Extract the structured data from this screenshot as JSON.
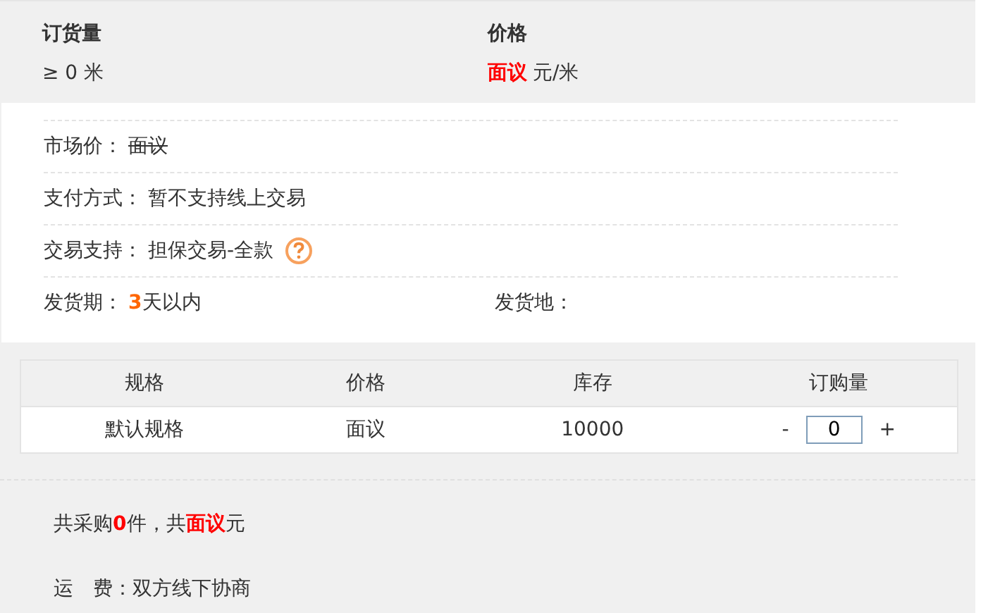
{
  "header": {
    "quantity_label": "订货量",
    "quantity_value": "≥ 0  米",
    "price_label": "价格",
    "price_value": "面议",
    "price_unit": "元/米"
  },
  "details": [
    {
      "label": "市场价：",
      "value": "面议",
      "strikethrough": true,
      "kind": "plain"
    },
    {
      "label": "支付方式：",
      "value": "暂不支持线上交易",
      "strikethrough": false,
      "kind": "plain"
    },
    {
      "label": "交易支持：",
      "value": "担保交易-全款",
      "strikethrough": false,
      "kind": "help"
    }
  ],
  "delivery": {
    "period_label": "发货期：",
    "period_number": "3",
    "period_text": "天以内",
    "place_label": "发货地："
  },
  "table": {
    "columns": [
      "规格",
      "价格",
      "库存",
      "订购量"
    ],
    "rows": [
      {
        "spec": "默认规格",
        "price": "面议",
        "stock": "10000",
        "minus": "-",
        "quantity": "0",
        "plus": "+"
      }
    ]
  },
  "summary": "共采购**0**件，共**面议**元",
  "shipping": "运　费：双方线下协商"
}
